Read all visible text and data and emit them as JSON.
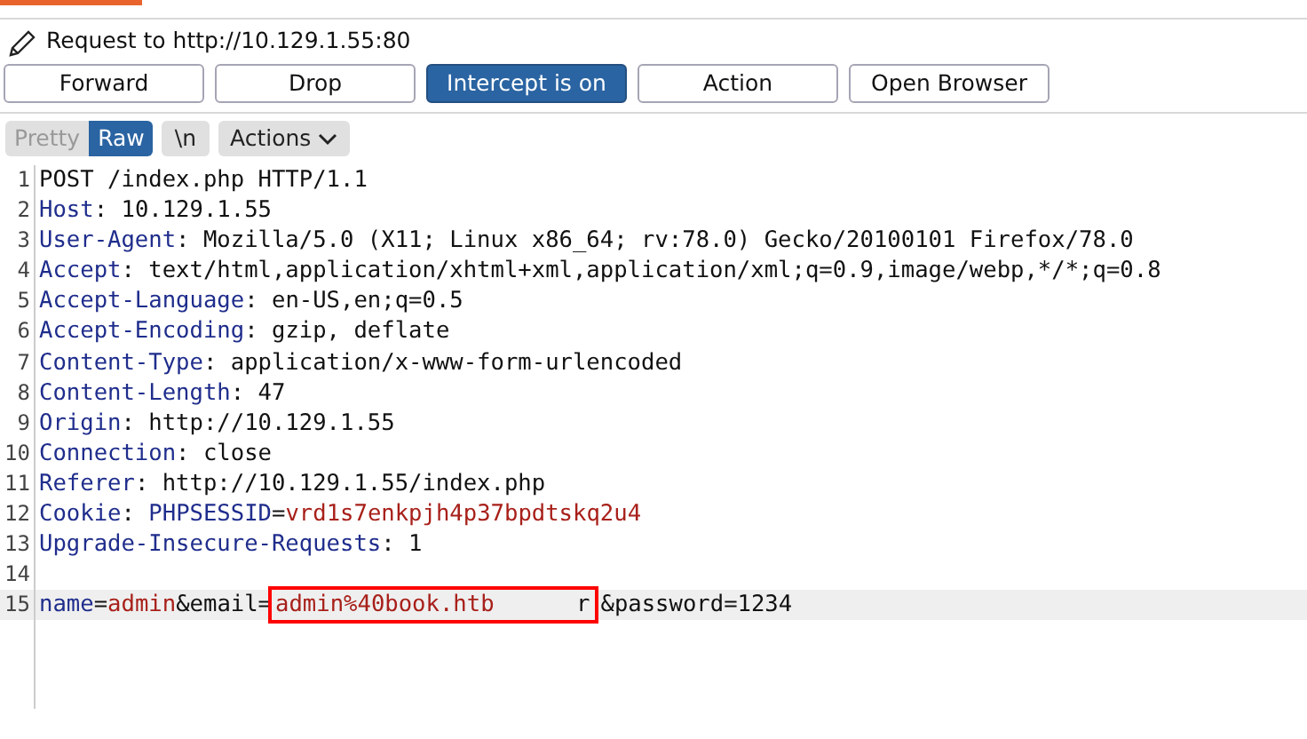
{
  "header": {
    "title": "Request to http://10.129.1.55:80"
  },
  "buttons": [
    {
      "label": "Forward",
      "selected": false
    },
    {
      "label": "Drop",
      "selected": false
    },
    {
      "label": "Intercept is on",
      "selected": true
    },
    {
      "label": "Action",
      "selected": false
    },
    {
      "label": "Open Browser",
      "selected": false
    }
  ],
  "view_tabs": [
    {
      "label": "Pretty",
      "selected": false
    },
    {
      "label": "Raw",
      "selected": true
    }
  ],
  "newline_toggle": {
    "label": "\\n",
    "selected": false
  },
  "actions_menu": {
    "label": "Actions"
  },
  "editor": {
    "lines": [
      {
        "number": "1",
        "current": false,
        "segments": [
          {
            "kind": "plain",
            "text": "POST /index.php HTTP/1.1"
          }
        ]
      },
      {
        "number": "2",
        "current": false,
        "segments": [
          {
            "kind": "key",
            "text": "Host"
          },
          {
            "kind": "plain",
            "text": ": 10.129.1.55"
          }
        ]
      },
      {
        "number": "3",
        "current": false,
        "segments": [
          {
            "kind": "key",
            "text": "User-Agent"
          },
          {
            "kind": "plain",
            "text": ": Mozilla/5.0 (X11; Linux x86_64; rv:78.0) Gecko/20100101 Firefox/78.0"
          }
        ]
      },
      {
        "number": "4",
        "current": false,
        "segments": [
          {
            "kind": "key",
            "text": "Accept"
          },
          {
            "kind": "plain",
            "text": ": text/html,application/xhtml+xml,application/xml;q=0.9,image/webp,*/*;q=0.8"
          }
        ]
      },
      {
        "number": "5",
        "current": false,
        "segments": [
          {
            "kind": "key",
            "text": "Accept-Language"
          },
          {
            "kind": "plain",
            "text": ": en-US,en;q=0.5"
          }
        ]
      },
      {
        "number": "6",
        "current": false,
        "segments": [
          {
            "kind": "key",
            "text": "Accept-Encoding"
          },
          {
            "kind": "plain",
            "text": ": gzip, deflate"
          }
        ]
      },
      {
        "number": "7",
        "current": false,
        "segments": [
          {
            "kind": "key",
            "text": "Content-Type"
          },
          {
            "kind": "plain",
            "text": ": application/x-www-form-urlencoded"
          }
        ]
      },
      {
        "number": "8",
        "current": false,
        "segments": [
          {
            "kind": "key",
            "text": "Content-Length"
          },
          {
            "kind": "plain",
            "text": ": 47"
          }
        ]
      },
      {
        "number": "9",
        "current": false,
        "segments": [
          {
            "kind": "key",
            "text": "Origin"
          },
          {
            "kind": "plain",
            "text": ": http://10.129.1.55"
          }
        ]
      },
      {
        "number": "10",
        "current": false,
        "segments": [
          {
            "kind": "key",
            "text": "Connection"
          },
          {
            "kind": "plain",
            "text": ": close"
          }
        ]
      },
      {
        "number": "11",
        "current": false,
        "segments": [
          {
            "kind": "key",
            "text": "Referer"
          },
          {
            "kind": "plain",
            "text": ": http://10.129.1.55/index.php"
          }
        ]
      },
      {
        "number": "12",
        "current": false,
        "segments": [
          {
            "kind": "key",
            "text": "Cookie"
          },
          {
            "kind": "plain",
            "text": ": "
          },
          {
            "kind": "key",
            "text": "PHPSESSID"
          },
          {
            "kind": "plain",
            "text": "="
          },
          {
            "kind": "value",
            "text": "vrd1s7enkpjh4p37bpdtskq2u4"
          }
        ]
      },
      {
        "number": "13",
        "current": false,
        "segments": [
          {
            "kind": "key",
            "text": "Upgrade-Insecure-Requests"
          },
          {
            "kind": "plain",
            "text": ": 1"
          }
        ]
      },
      {
        "number": "14",
        "current": false
      },
      {
        "number": "15",
        "current": true,
        "segments": [
          {
            "kind": "key",
            "text": "name"
          },
          {
            "kind": "plain",
            "text": "="
          },
          {
            "kind": "value",
            "text": "admin"
          },
          {
            "kind": "plain",
            "text": "&email="
          },
          {
            "kind": "value",
            "text": "admin%40book.htb",
            "boxed": true
          },
          {
            "kind": "plain",
            "text": "      r",
            "boxed": true
          },
          {
            "kind": "plain",
            "text": "&password=1234"
          }
        ]
      }
    ]
  }
}
